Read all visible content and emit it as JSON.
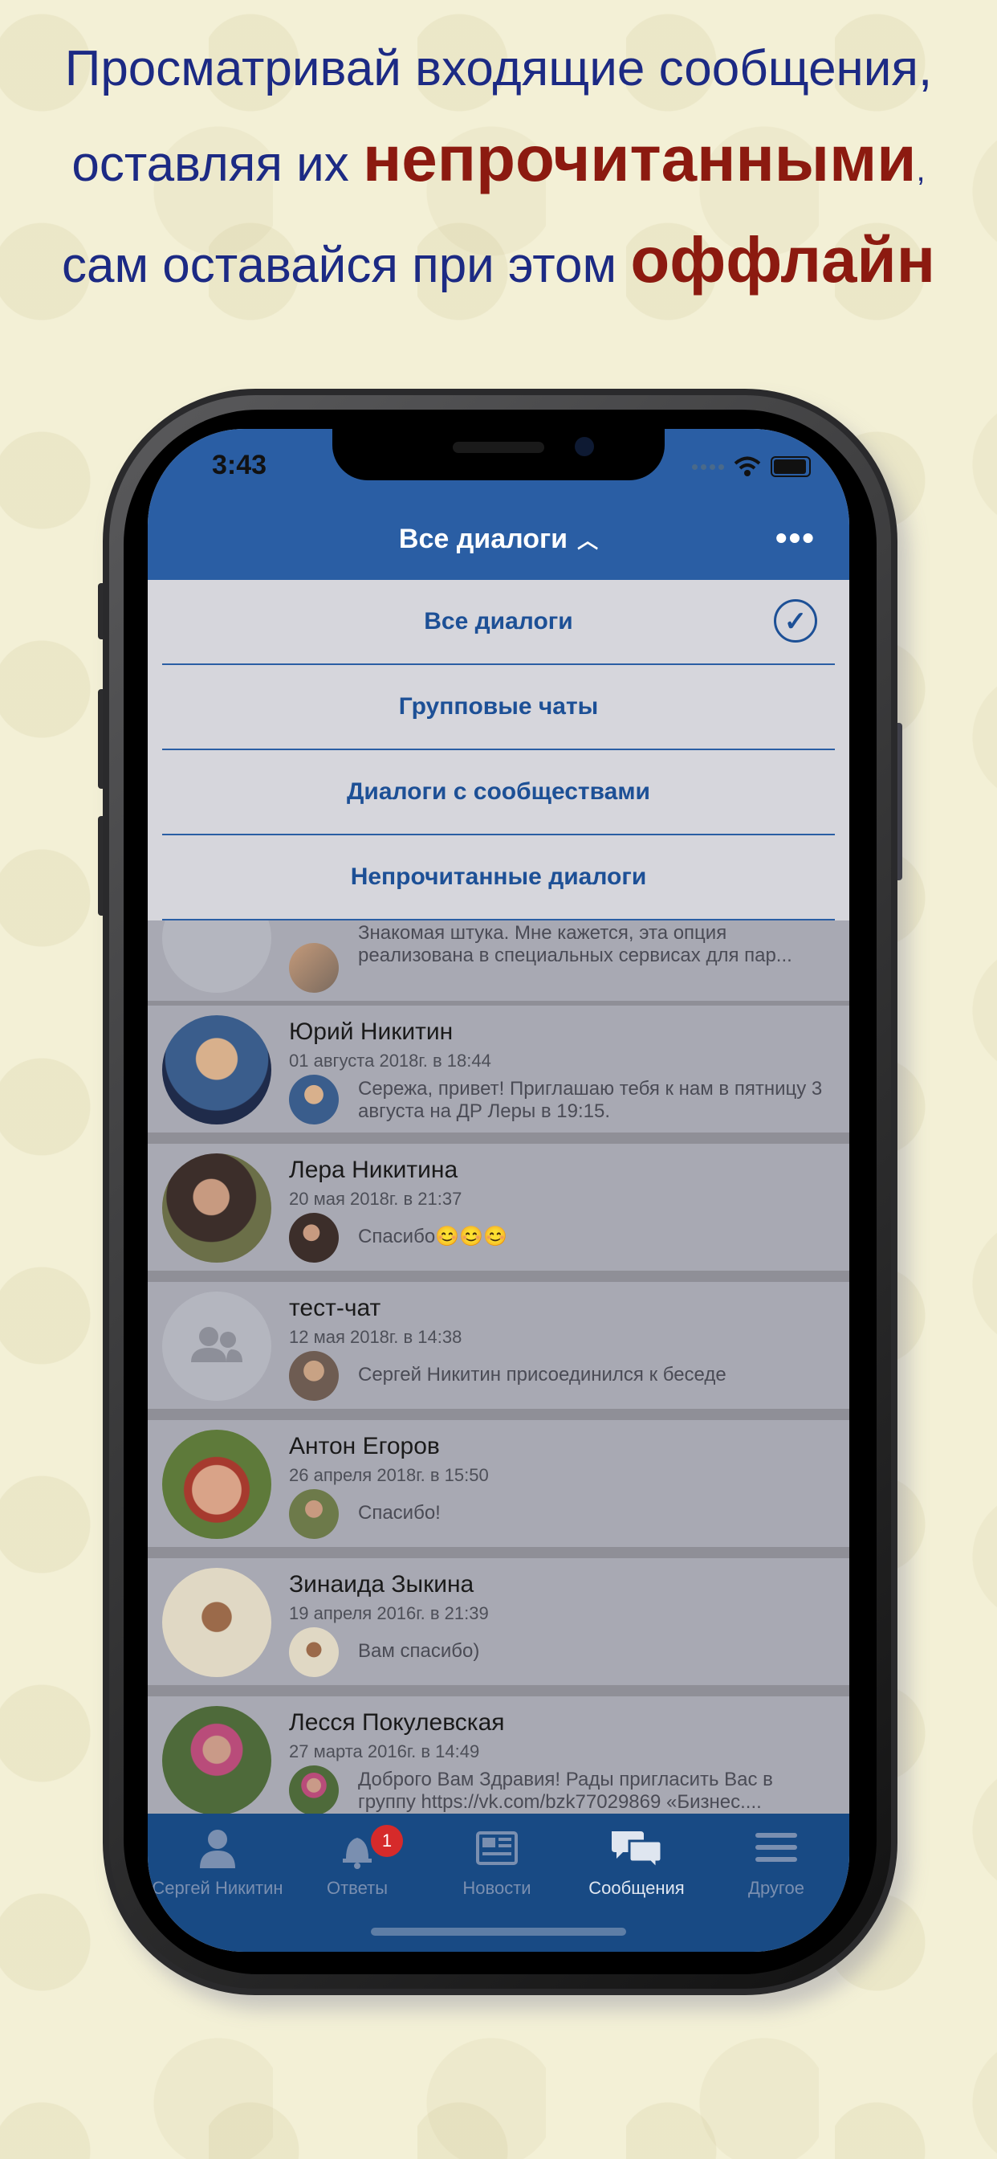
{
  "promo": {
    "line1": "Просматривай входящие сообщения,",
    "line2_prefix": "оставляя их ",
    "line2_highlight": "непрочитанными",
    "line2_suffix": ",",
    "line3_prefix": "сам оставайся при этом ",
    "line3_highlight": "оффлайн"
  },
  "status": {
    "time": "3:43"
  },
  "nav": {
    "title": "Все диалоги",
    "more_icon": "more-dots-icon"
  },
  "dropdown": {
    "items": [
      {
        "label": "Все диалоги",
        "selected": true
      },
      {
        "label": "Групповые чаты"
      },
      {
        "label": "Диалоги с сообществами"
      },
      {
        "label": "Непрочитанные диалоги"
      }
    ]
  },
  "dialogs": [
    {
      "name": "",
      "date": "",
      "preview": "Знакомая штука. Мне кажется, эта опция реализована в специальных сервисах для пар..."
    },
    {
      "name": "Юрий Никитин",
      "date": "01 августа 2018г. в 18:44",
      "preview": "Сережа, привет! Приглашаю тебя к нам в пятницу 3 августа на ДР Леры в 19:15."
    },
    {
      "name": "Лера Никитина",
      "date": "20 мая 2018г. в 21:37",
      "preview": "Спасибо😊😊😊"
    },
    {
      "name": "тест-чат",
      "date": "12 мая 2018г. в 14:38",
      "preview": "Сергей Никитин присоединился к беседе"
    },
    {
      "name": "Антон Егоров",
      "date": "26 апреля 2018г. в 15:50",
      "preview": "Спасибо!"
    },
    {
      "name": "Зинаида Зыкина",
      "date": "19 апреля 2016г. в 21:39",
      "preview": "Вам спасибо)"
    },
    {
      "name": "Лесся Покулевская",
      "date": "27 марта 2016г. в 14:49",
      "preview": "Доброго Вам Здравия! Рады пригласить Вас в группу https://vk.com/bzk77029869 «Бизнес...."
    }
  ],
  "tabs": [
    {
      "label": "Сергей Никитин",
      "icon": "profile-icon"
    },
    {
      "label": "Ответы",
      "icon": "bell-icon",
      "badge": "1"
    },
    {
      "label": "Новости",
      "icon": "news-icon"
    },
    {
      "label": "Сообщения",
      "icon": "messages-icon",
      "active": true
    },
    {
      "label": "Другое",
      "icon": "menu-icon"
    }
  ],
  "colors": {
    "promo_text": "#1c2a84",
    "promo_highlight": "#8c1a10",
    "nav": "#2a5ea4",
    "tabbar": "#184a84",
    "badge": "#d62a2a"
  }
}
